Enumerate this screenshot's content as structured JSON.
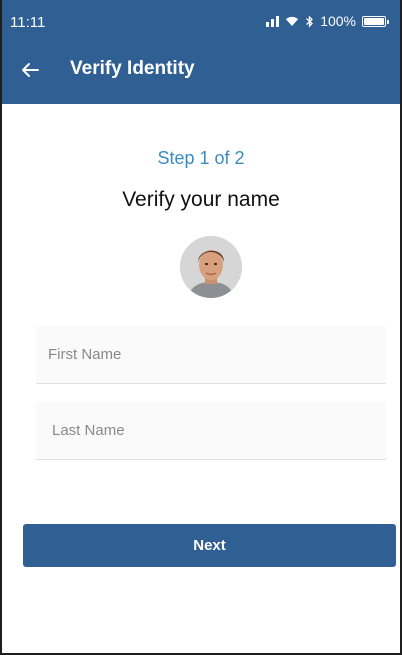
{
  "status_bar": {
    "time": "11:11",
    "battery": "100%",
    "icons": [
      "signal-icon",
      "wifi-icon",
      "bluetooth-icon",
      "battery-icon"
    ]
  },
  "app_bar": {
    "back_icon": "arrow-left-icon",
    "title": "Verify Identity"
  },
  "form": {
    "step": "Step 1 of 2",
    "heading": "Verify your name",
    "avatar": "user-avatar",
    "first_name": {
      "value": "",
      "placeholder": "First Name"
    },
    "last_name": {
      "value": "",
      "placeholder": "Last Name"
    },
    "next_label": "Next"
  },
  "colors": {
    "primary": "#2f5f93",
    "step_accent": "#3b8dc0",
    "field_background": "#fafafa",
    "text": "#111111"
  }
}
